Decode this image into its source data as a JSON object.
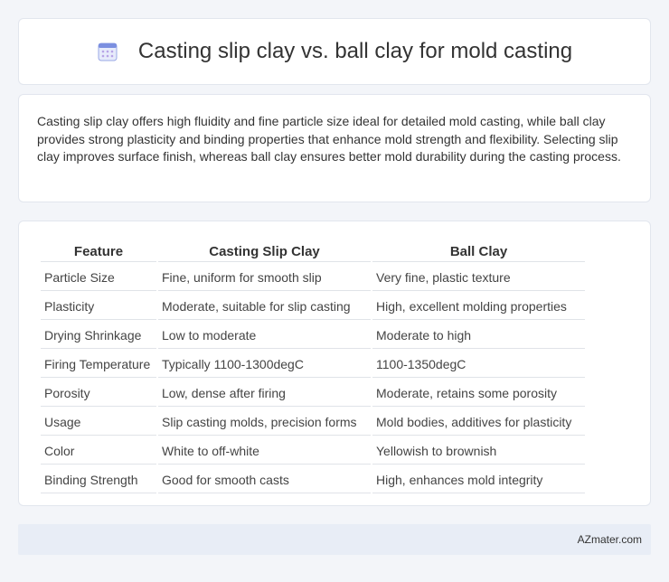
{
  "header": {
    "title": "Casting slip clay vs. ball clay for mold casting",
    "icon": "calendar-icon"
  },
  "intro": {
    "text": "Casting slip clay offers high fluidity and fine particle size ideal for detailed mold casting, while ball clay provides strong plasticity and binding properties that enhance mold strength and flexibility. Selecting slip clay improves surface finish, whereas ball clay ensures better mold durability during the casting process."
  },
  "table": {
    "headers": [
      "Feature",
      "Casting Slip Clay",
      "Ball Clay"
    ],
    "rows": [
      [
        "Particle Size",
        "Fine, uniform for smooth slip",
        "Very fine, plastic texture"
      ],
      [
        "Plasticity",
        "Moderate, suitable for slip casting",
        "High, excellent molding properties"
      ],
      [
        "Drying Shrinkage",
        "Low to moderate",
        "Moderate to high"
      ],
      [
        "Firing Temperature",
        "Typically 1100-1300degC",
        "1100-1350degC"
      ],
      [
        "Porosity",
        "Low, dense after firing",
        "Moderate, retains some porosity"
      ],
      [
        "Usage",
        "Slip casting molds, precision forms",
        "Mold bodies, additives for plasticity"
      ],
      [
        "Color",
        "White to off-white",
        "Yellowish to brownish"
      ],
      [
        "Binding Strength",
        "Good for smooth casts",
        "High, enhances mold integrity"
      ]
    ]
  },
  "footer": {
    "text": "AZmater.com"
  },
  "colors": {
    "background": "#f3f5f9",
    "footer_bg": "#e8edf6",
    "icon_accent": "#7b8fe0"
  }
}
